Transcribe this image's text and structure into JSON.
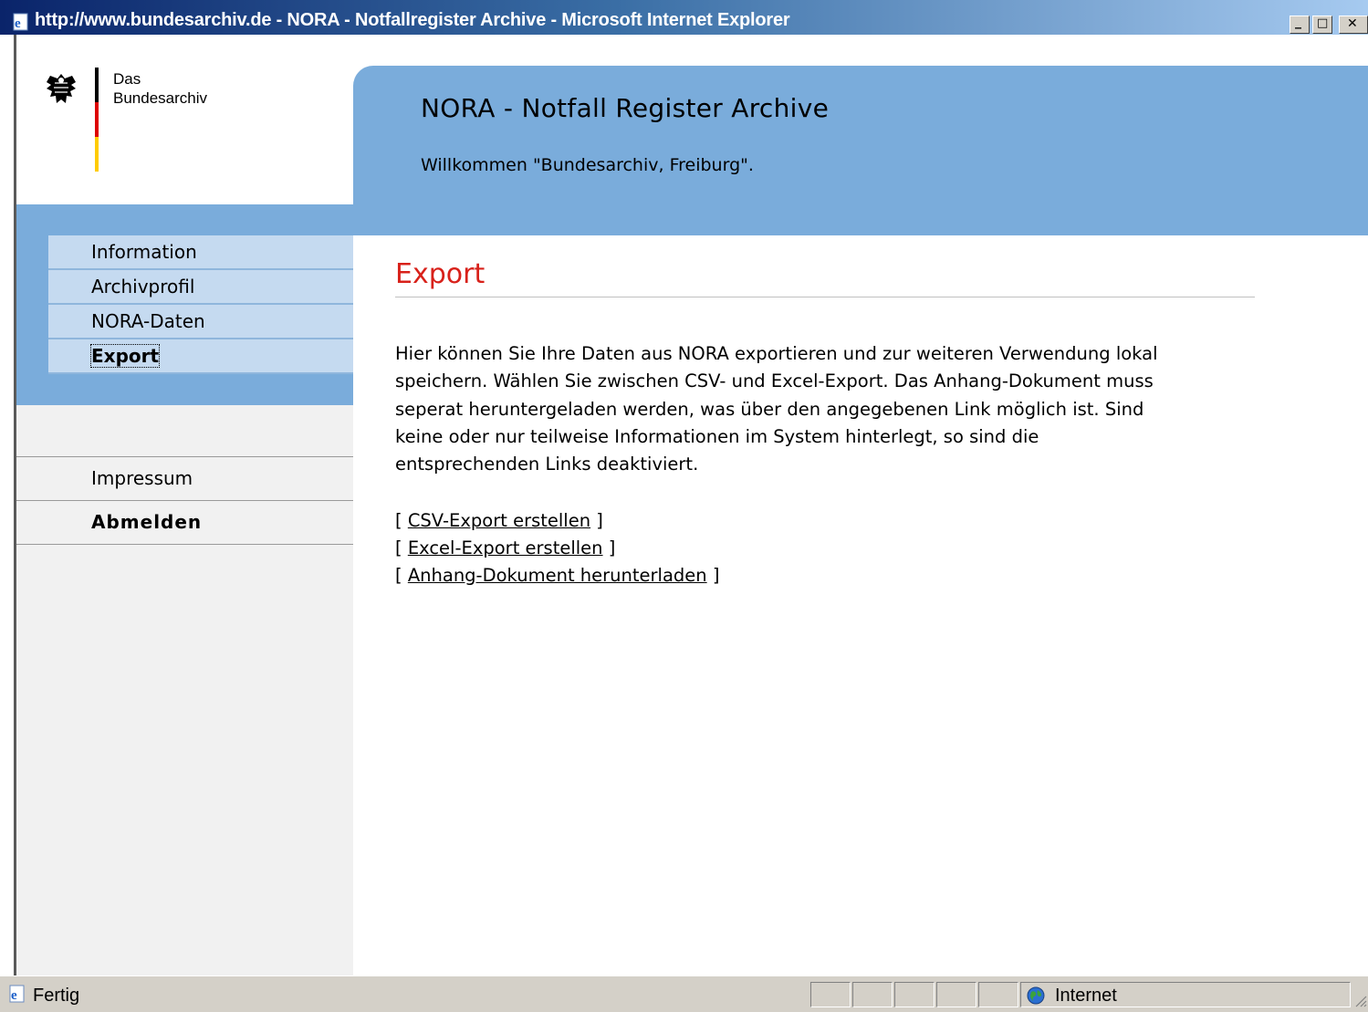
{
  "window": {
    "title": "http://www.bundesarchiv.de - NORA - Notfallregister Archive - Microsoft Internet Explorer"
  },
  "logo": {
    "line1": "Das",
    "line2": "Bundesarchiv"
  },
  "header": {
    "title": "NORA - Notfall Register Archive",
    "welcome": "Willkommen \"Bundesarchiv, Freiburg\"."
  },
  "sidebar": {
    "items": [
      {
        "label": "Information"
      },
      {
        "label": "Archivprofil"
      },
      {
        "label": "NORA-Daten"
      },
      {
        "label": "Export",
        "active": true
      }
    ],
    "lower_items": [
      {
        "label": "Impressum"
      },
      {
        "label": "Abmelden"
      }
    ]
  },
  "main": {
    "title": "Export",
    "intro_lines": [
      "Hier können Sie Ihre Daten aus NORA exportieren und zur weiteren Verwendung lokal",
      "speichern. Wählen Sie zwischen CSV- und Excel-Export. Das Anhang-Dokument muss",
      "seperat heruntergeladen werden, was über den angegebenen Link möglich ist. Sind",
      "keine oder nur teilweise Informationen im System hinterlegt, so sind die",
      "entsprechenden Links deaktiviert."
    ],
    "links": [
      {
        "label": "CSV-Export erstellen"
      },
      {
        "label": "Excel-Export erstellen"
      },
      {
        "label": "Anhang-Dokument herunterladen"
      }
    ],
    "bracket_open": "[",
    "bracket_close": "]"
  },
  "statusbar": {
    "status": "Fertig",
    "zone": "Internet"
  },
  "colors": {
    "header_blue": "#7aacdb",
    "nav_item_bg": "#c5daf0",
    "title_red": "#d8211a"
  },
  "icons": {
    "browser": "ie-page-icon",
    "emblem": "federal-eagle-icon",
    "zone": "globe-icon"
  }
}
